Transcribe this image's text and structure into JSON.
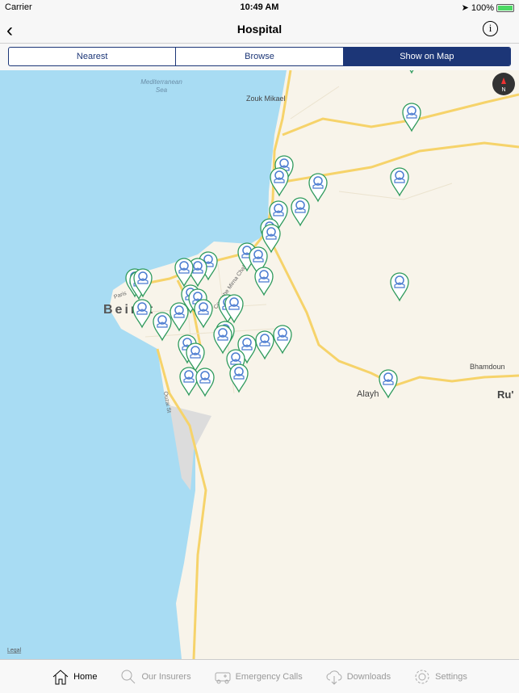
{
  "status": {
    "carrier": "Carrier",
    "time": "10:49 AM",
    "battery": "100%"
  },
  "nav": {
    "title": "Hospital",
    "back_icon": "chevron-left",
    "info_icon": "info-circle",
    "info_glyph": "i",
    "back_glyph": "‹"
  },
  "segments": [
    {
      "label": "Nearest"
    },
    {
      "label": "Browse"
    },
    {
      "label": "Show on Map",
      "selected": true
    }
  ],
  "map": {
    "labels": {
      "sea": "Mediterranean Sea",
      "sea1": "Mediterranean",
      "sea2": "Sea",
      "zouk": "Zouk Mikael",
      "beirut": "Beirut",
      "alayh": "Alayh",
      "bhamdoun": "Bhamdoun",
      "ru": "Ru'",
      "ouzai": "Ouzai St",
      "paris": "Paris",
      "corniche": "Corniche Mirna Chalouhi"
    },
    "legal": "Legal",
    "compass": "N",
    "marker_type": "hospital-pin",
    "marker_color": "#2e9a5c",
    "sea_color": "#a8dcf3",
    "land_color": "#f8f4ea",
    "road_color": "#f6d36a"
  },
  "tabs": [
    {
      "label": "Home",
      "icon": "home",
      "active": true
    },
    {
      "label": "Our Insurers",
      "icon": "search"
    },
    {
      "label": "Emergency Calls",
      "icon": "ambulance"
    },
    {
      "label": "Downloads",
      "icon": "cloud-download"
    },
    {
      "label": "Settings",
      "icon": "gear"
    }
  ]
}
